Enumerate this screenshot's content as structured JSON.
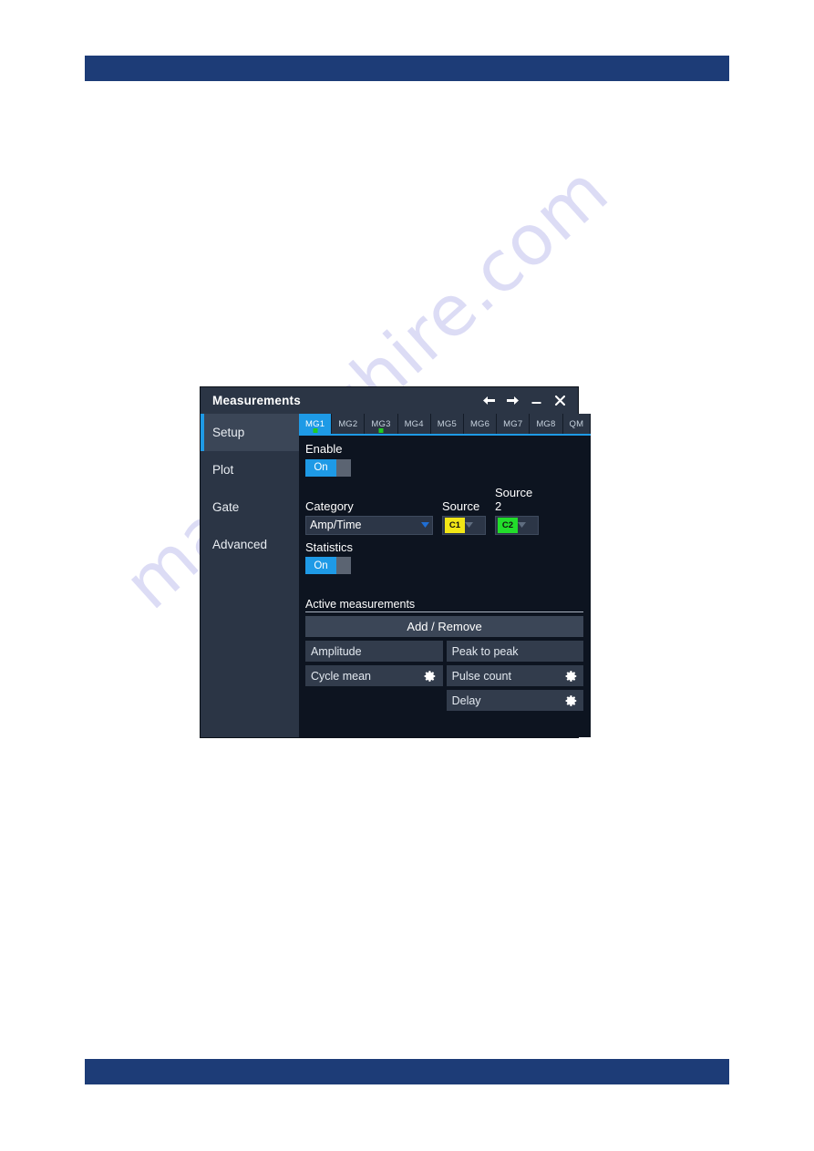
{
  "page": {
    "header_bar": "",
    "footer_bar": "",
    "watermark": "manualshire.com",
    "accent_blue": "#1d3c77"
  },
  "dialog": {
    "title": "Measurements",
    "titlebar_buttons": [
      {
        "name": "back-arrow-icon",
        "label": "←"
      },
      {
        "name": "forward-arrow-icon",
        "label": "→"
      },
      {
        "name": "minimize-icon",
        "label": "–"
      },
      {
        "name": "close-icon",
        "label": "✕"
      }
    ],
    "sidebar": {
      "items": [
        {
          "label": "Setup",
          "active": true
        },
        {
          "label": "Plot",
          "active": false
        },
        {
          "label": "Gate",
          "active": false
        },
        {
          "label": "Advanced",
          "active": false
        }
      ]
    },
    "tabs": [
      {
        "label": "MG1",
        "active": true,
        "dot": true
      },
      {
        "label": "MG2",
        "active": false,
        "dot": false
      },
      {
        "label": "MG3",
        "active": false,
        "dot": true
      },
      {
        "label": "MG4",
        "active": false,
        "dot": false
      },
      {
        "label": "MG5",
        "active": false,
        "dot": false
      },
      {
        "label": "MG6",
        "active": false,
        "dot": false
      },
      {
        "label": "MG7",
        "active": false,
        "dot": false
      },
      {
        "label": "MG8",
        "active": false,
        "dot": false
      },
      {
        "label": "QM",
        "active": false,
        "dot": false
      }
    ],
    "setup": {
      "enable_label": "Enable",
      "enable_value": "On",
      "category_label": "Category",
      "category_value": "Amp/Time",
      "source_label": "Source",
      "source_value": "C1",
      "source_color": "#f2e616",
      "source2_label": "Source 2",
      "source2_value": "C2",
      "source2_color": "#22dd2b",
      "statistics_label": "Statistics",
      "statistics_value": "On",
      "active_measurements_label": "Active measurements",
      "add_remove_label": "Add / Remove",
      "measurements": [
        {
          "label": "Amplitude",
          "gear": false
        },
        {
          "label": "Peak to peak",
          "gear": false
        },
        {
          "label": "Cycle mean",
          "gear": true
        },
        {
          "label": "Pulse count",
          "gear": true
        },
        {
          "label": "",
          "gear": false,
          "empty": true
        },
        {
          "label": "Delay",
          "gear": true
        }
      ]
    }
  }
}
